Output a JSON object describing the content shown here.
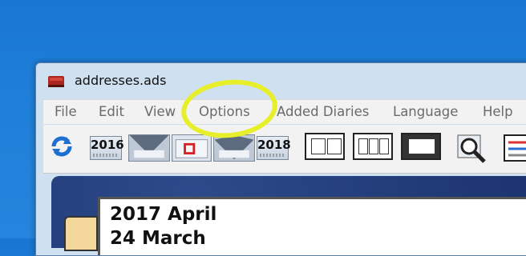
{
  "window": {
    "title": "addresses.ads"
  },
  "menu": [
    "File",
    "Edit",
    "View",
    "Options",
    "Added Diaries",
    "Language",
    "Help"
  ],
  "toolbar": {
    "year_prev": "2016",
    "year_next": "2018",
    "icons": [
      "refresh-icon",
      "calendar-prev-icon",
      "calendar-today-icon",
      "calendar-next-icon",
      "view-two-pane-icon",
      "view-three-pane-icon",
      "view-list-icon",
      "search-icon",
      "table-icon"
    ]
  },
  "diary": {
    "month_title": "2017 April",
    "week_label": "24 March"
  },
  "colors": {
    "highlight": "#e7ef2a",
    "desktop": "#1e7fd8"
  }
}
